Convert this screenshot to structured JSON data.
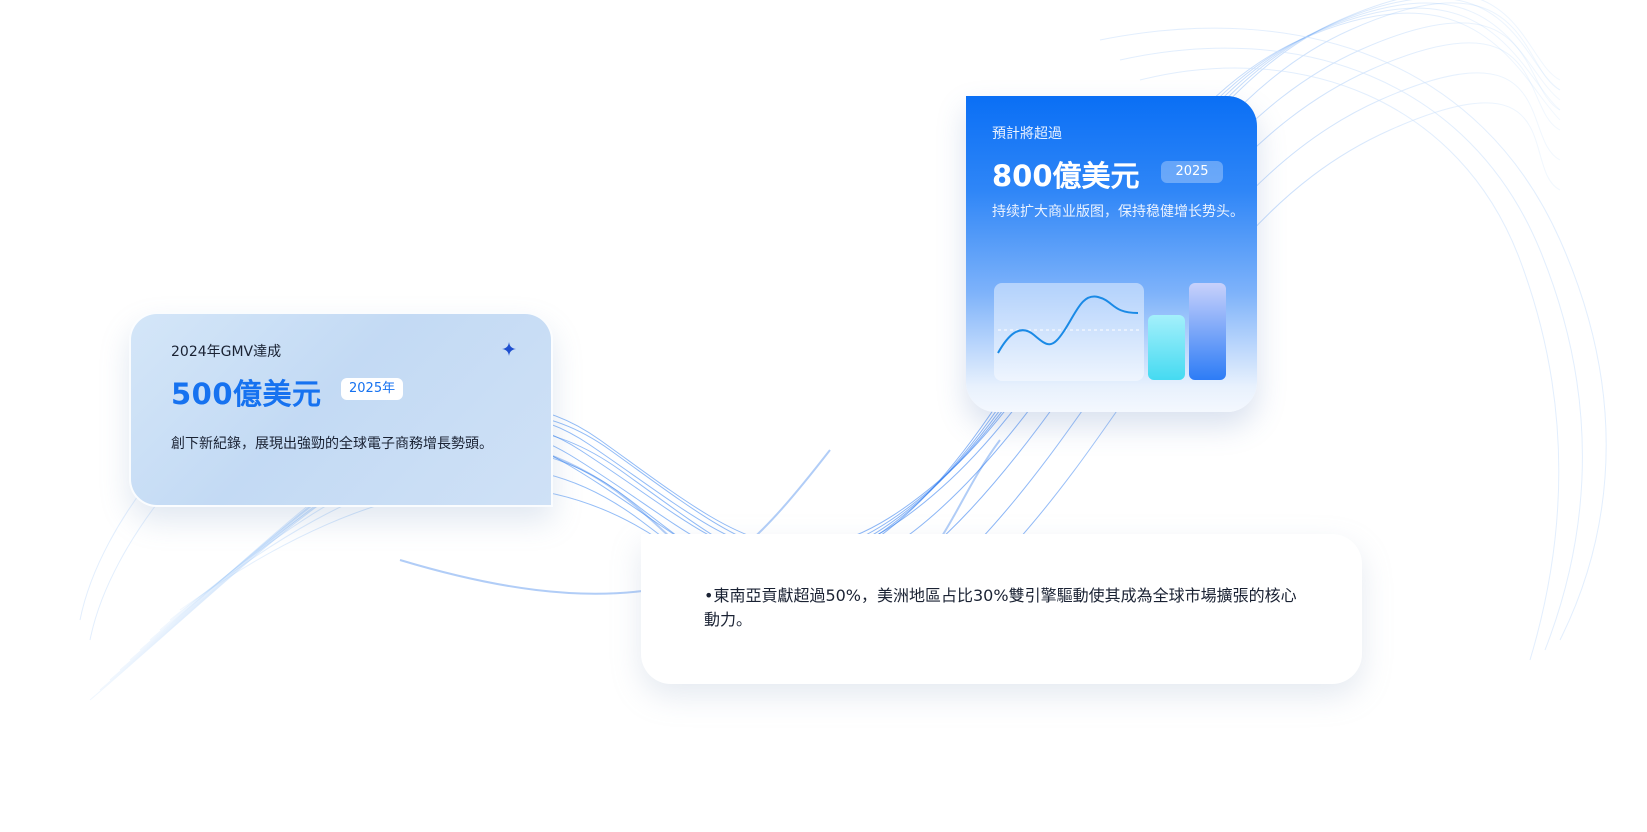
{
  "colors": {
    "primary_blue": "#1672f0",
    "card2_top": "#0a6ff5",
    "text_dark": "#1a2233",
    "wave_blue": "#2f7ef2"
  },
  "card_2024": {
    "subtitle": "2024年GMV達成",
    "value": "500億美元",
    "badge": "2025年",
    "description": "創下新紀錄，展現出強勁的全球電子商務增長勢頭。",
    "icon": "sparkle-icon"
  },
  "card_2025": {
    "subtitle": "預計將超過",
    "value": "800億美元",
    "badge": "2025",
    "description": "持续扩大商业版图，保持稳健增长势头。",
    "mini_bars": [
      0.67,
      1.0
    ]
  },
  "card_regions": {
    "text": "•東南亞貢獻超過50%，美洲地區占比30%雙引擎驅動使其成為全球市場擴張的核心動力。"
  }
}
